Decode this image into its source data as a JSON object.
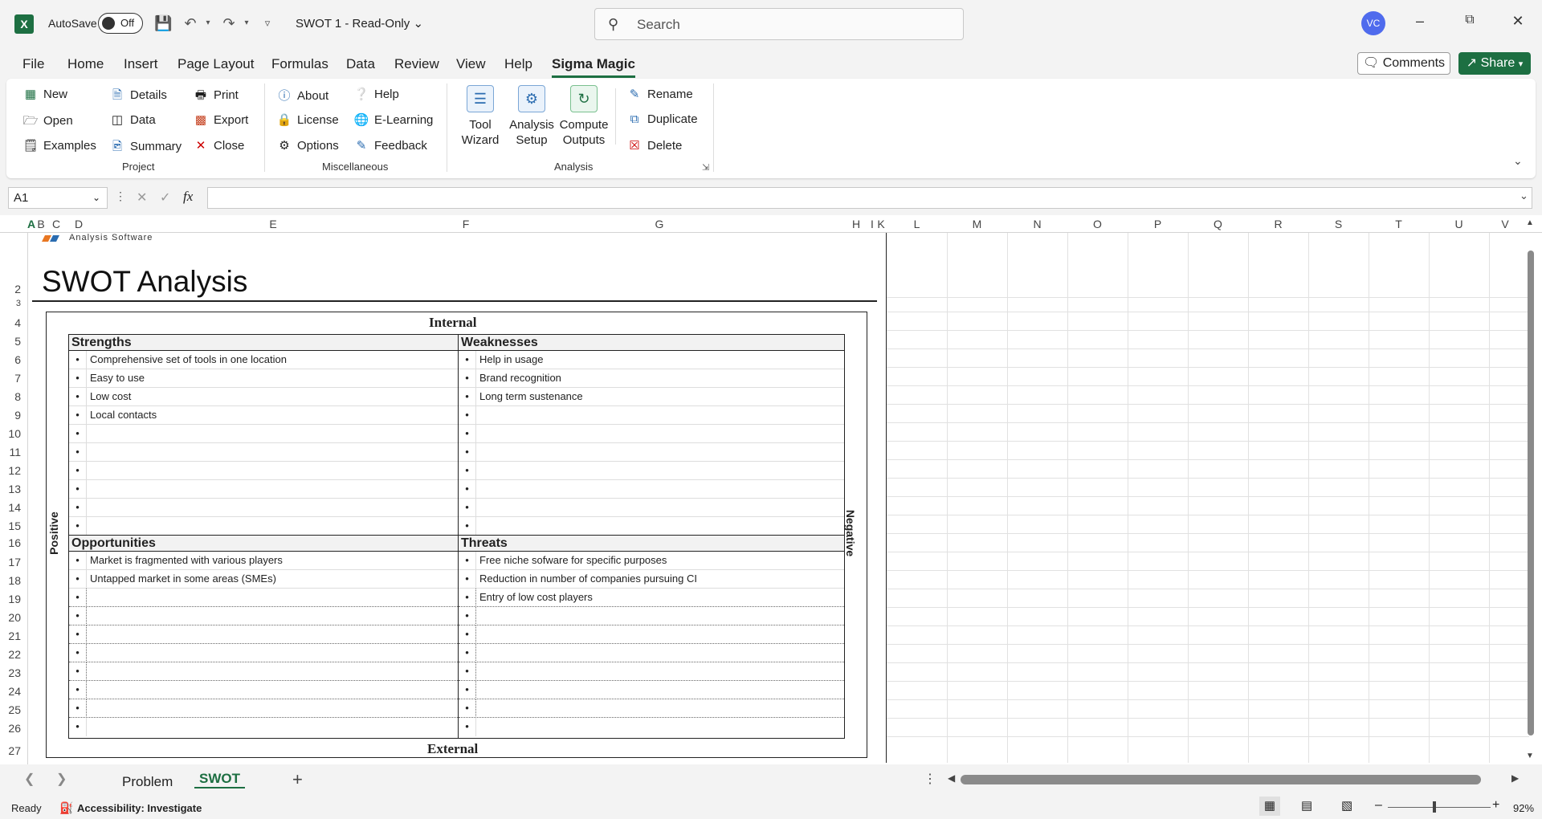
{
  "titlebar": {
    "logo_letter": "X",
    "autosave_label": "AutoSave",
    "autosave_state": "Off",
    "doc_title": "SWOT 1  -  Read-Only",
    "search_placeholder": "Search",
    "avatar_initials": "VC",
    "accent_color": "#1d6f42"
  },
  "menu": {
    "items": [
      "File",
      "Home",
      "Insert",
      "Page Layout",
      "Formulas",
      "Data",
      "Review",
      "View",
      "Help",
      "Sigma Magic"
    ],
    "active": "Sigma Magic",
    "comments_label": "Comments",
    "share_label": "Share"
  },
  "ribbon": {
    "project": {
      "label": "Project",
      "buttons": [
        "New",
        "Open",
        "Examples",
        "Details",
        "Data",
        "Summary",
        "Print",
        "Export",
        "Close"
      ]
    },
    "misc": {
      "label": "Miscellaneous",
      "buttons": [
        "About",
        "License",
        "Options",
        "Help",
        "E-Learning",
        "Feedback"
      ]
    },
    "analysis": {
      "label": "Analysis",
      "big_buttons": [
        {
          "line1": "Tool",
          "line2": "Wizard"
        },
        {
          "line1": "Analysis",
          "line2": "Setup"
        },
        {
          "line1": "Compute",
          "line2": "Outputs"
        }
      ],
      "buttons": [
        "Rename",
        "Duplicate",
        "Delete"
      ]
    }
  },
  "formula_bar": {
    "name_box": "A1",
    "fx": "fx",
    "value": ""
  },
  "grid": {
    "columns": [
      "A",
      "B",
      "C",
      "D",
      "E",
      "F",
      "G",
      "H",
      "I",
      "K",
      "L",
      "M",
      "N",
      "O",
      "P",
      "Q",
      "R",
      "S",
      "T",
      "U",
      "V"
    ],
    "rows": [
      "2",
      "3",
      "4",
      "5",
      "6",
      "7",
      "8",
      "9",
      "10",
      "11",
      "12",
      "13",
      "14",
      "15",
      "16",
      "17",
      "18",
      "19",
      "20",
      "21",
      "22",
      "23",
      "24",
      "25",
      "26",
      "27"
    ]
  },
  "sheet": {
    "logo_caption": "Analysis Software",
    "title": "SWOT Analysis",
    "internal_label": "Internal",
    "external_label": "External",
    "positive_label": "Positive",
    "negative_label": "Negative",
    "strengths": {
      "header": "Strengths",
      "items": [
        "Comprehensive set of tools in one location",
        "Easy to use",
        "Low cost",
        "Local contacts",
        "",
        "",
        "",
        "",
        "",
        ""
      ]
    },
    "weaknesses": {
      "header": "Weaknesses",
      "items": [
        "Help in usage",
        "Brand recognition",
        "Long term sustenance",
        "",
        "",
        "",
        "",
        "",
        "",
        ""
      ]
    },
    "opportunities": {
      "header": "Opportunities",
      "items": [
        "Market is fragmented with various players",
        "Untapped market in some areas (SMEs)",
        "",
        "",
        "",
        "",
        "",
        "",
        "",
        ""
      ]
    },
    "threats": {
      "header": "Threats",
      "items": [
        "Free niche sofware for specific purposes",
        "Reduction in number of companies pursuing CI",
        "Entry of low cost players",
        "",
        "",
        "",
        "",
        "",
        "",
        ""
      ]
    }
  },
  "tabs": {
    "items": [
      "Problem",
      "SWOT"
    ],
    "active": "SWOT"
  },
  "status": {
    "ready": "Ready",
    "accessibility": "Accessibility: Investigate",
    "zoom": "92%"
  }
}
